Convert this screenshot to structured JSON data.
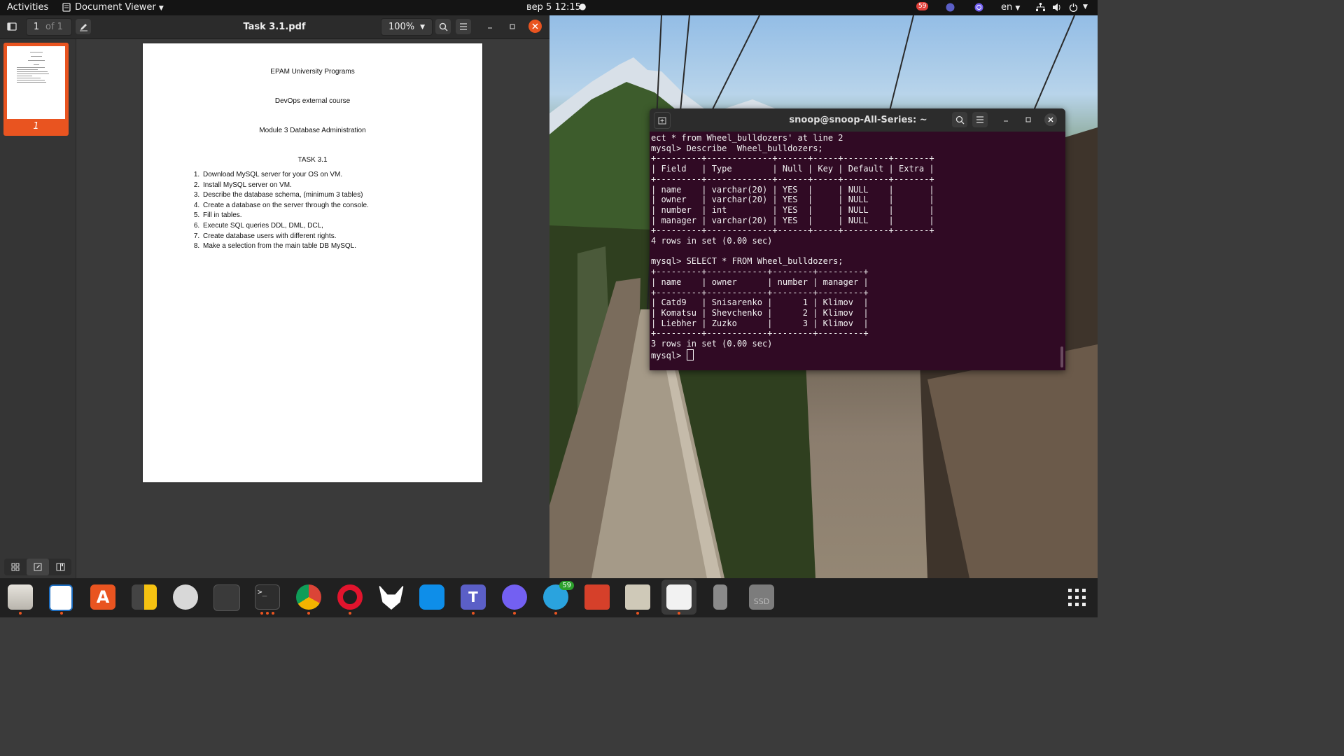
{
  "topbar": {
    "activities": "Activities",
    "app_menu": "Document Viewer",
    "clock": "вер 5  12:15",
    "notification_count": "59",
    "lang": "en"
  },
  "document_viewer": {
    "page_current": "1",
    "page_total": "of 1",
    "title": "Task 3.1.pdf",
    "zoom": "100%",
    "thumbnail_label": "1",
    "document": {
      "line1": "EPAM University Programs",
      "line2": "DevOps external course",
      "line3": "Module 3 Database Administration",
      "heading": "TASK 3.1",
      "items": [
        "Download MySQL server for your OS on VM.",
        "Install MySQL server on VM.",
        "Describe the database schema, (minimum 3 tables)",
        "Create a database on the server through the console.",
        "Fill in tables.",
        "Execute SQL queries DDL, DML, DCL,",
        "Create database users with different rights.",
        "Make a selection from the main table DB  MySQL."
      ]
    }
  },
  "terminal": {
    "title": "snoop@snoop-All-Series: ~",
    "lines": [
      "ect * from Wheel_bulldozers' at line 2",
      "mysql> Describe  Wheel_bulldozers;",
      "+---------+-------------+------+-----+---------+-------+",
      "| Field   | Type        | Null | Key | Default | Extra |",
      "+---------+-------------+------+-----+---------+-------+",
      "| name    | varchar(20) | YES  |     | NULL    |       |",
      "| owner   | varchar(20) | YES  |     | NULL    |       |",
      "| number  | int         | YES  |     | NULL    |       |",
      "| manager | varchar(20) | YES  |     | NULL    |       |",
      "+---------+-------------+------+-----+---------+-------+",
      "4 rows in set (0.00 sec)",
      "",
      "mysql> SELECT * FROM Wheel_bulldozers;",
      "+---------+------------+--------+---------+",
      "| name    | owner      | number | manager |",
      "+---------+------------+--------+---------+",
      "| Catd9   | Snisarenko |      1 | Klimov  |",
      "| Komatsu | Shevchenko |      2 | Klimov  |",
      "| Liebher | Zuzko      |      3 | Klimov  |",
      "+---------+------------+--------+---------+",
      "3 rows in set (0.00 sec)",
      ""
    ],
    "prompt": "mysql> "
  },
  "dock": {
    "telegram_badge": "59",
    "ssd_label": "SSD"
  },
  "colors": {
    "accent": "#e95420",
    "terminal_bg": "#300a24",
    "topbar_bg": "#141414"
  }
}
